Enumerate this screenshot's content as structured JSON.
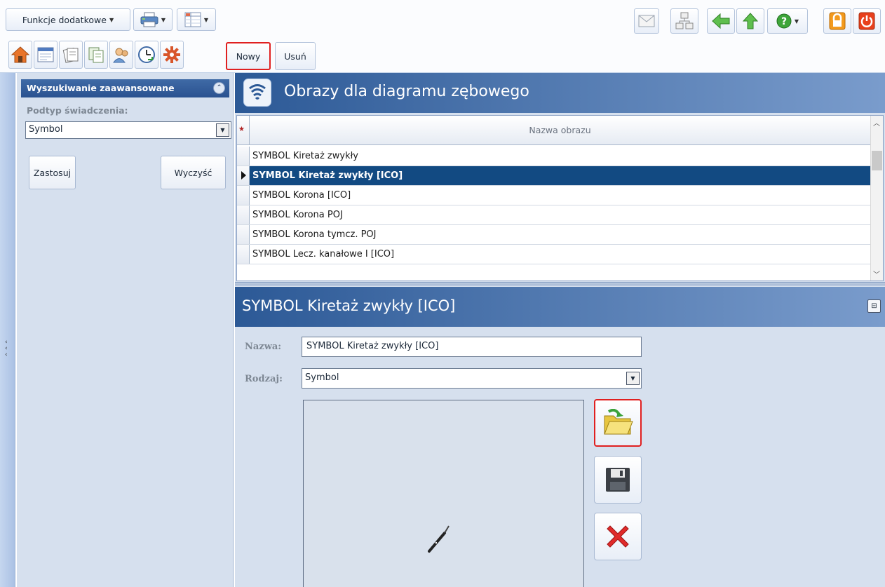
{
  "toolbar": {
    "extra_functions_label": "Funkcje dodatkowe",
    "new_label": "Nowy",
    "delete_label": "Usuń"
  },
  "sidebar": {
    "header": "Wyszukiwanie zaawansowane",
    "subtype_label": "Podtyp świadczenia:",
    "subtype_value": "Symbol",
    "apply_label": "Zastosuj",
    "clear_label": "Wyczyść"
  },
  "main": {
    "title": "Obrazy dla diagramu zębowego",
    "grid": {
      "column": "Nazwa obrazu",
      "rows": [
        {
          "name": "SYMBOL Kiretaż zwykły"
        },
        {
          "name": "SYMBOL Kiretaż zwykły [ICO]"
        },
        {
          "name": "SYMBOL Korona [ICO]"
        },
        {
          "name": "SYMBOL Korona POJ"
        },
        {
          "name": "SYMBOL Korona tymcz. POJ"
        },
        {
          "name": "SYMBOL Lecz. kanałowe I [ICO]"
        }
      ],
      "selected_index": 1
    }
  },
  "detail": {
    "title": "SYMBOL Kiretaż zwykły [ICO]",
    "name_label": "Nazwa:",
    "name_value": "SYMBOL Kiretaż zwykły [ICO]",
    "type_label": "Rodzaj:",
    "type_value": "Symbol"
  },
  "icons": {
    "toolbar_left": [
      "house-icon",
      "calendar-icon",
      "documents-icon",
      "copy-icon",
      "users-icon",
      "clock-icon",
      "gear-icon"
    ],
    "toolbar_right": [
      "mail-icon",
      "network-icon",
      "back-arrow-icon",
      "up-arrow-icon",
      "help-icon",
      "lock-icon",
      "power-icon"
    ],
    "detail_buttons": [
      "open-folder-icon",
      "save-icon",
      "delete-icon"
    ]
  },
  "colors": {
    "header_blue": "#2c5996",
    "selected_row": "#124a82",
    "highlight_red": "#e02020",
    "panel_bg": "#d6e0ee"
  }
}
